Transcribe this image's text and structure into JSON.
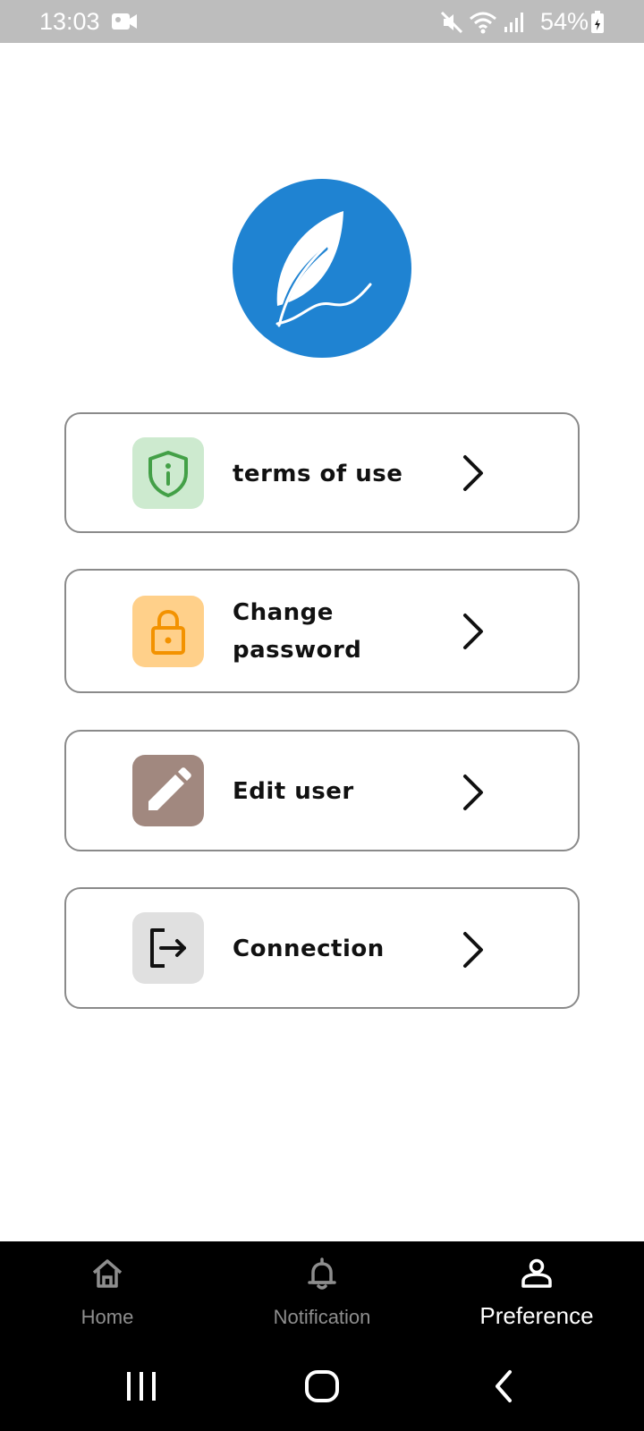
{
  "status_bar": {
    "time": "13:03",
    "battery": "54%",
    "icons": [
      "video-camera-icon",
      "mute-icon",
      "wifi-icon",
      "signal-icon",
      "battery-charging-icon"
    ]
  },
  "logo": {
    "icon": "leaf-quill-icon",
    "color": "#1f83d2"
  },
  "menu": {
    "items": [
      {
        "label": "terms of use",
        "icon": "shield-info-icon",
        "icon_bg": "#cdeacf",
        "icon_color": "#43a047"
      },
      {
        "label_line1": "Change",
        "label_line2": "password",
        "icon": "lock-icon",
        "icon_bg": "#ffd08a",
        "icon_color": "#f39200"
      },
      {
        "label": "Edit user",
        "icon": "pencil-icon",
        "icon_bg": "#a1887f",
        "icon_color": "#ffffff"
      },
      {
        "label": "Connection",
        "icon": "logout-icon",
        "icon_bg": "#e0e0e0",
        "icon_color": "#111111"
      }
    ]
  },
  "bottom_nav": {
    "items": [
      {
        "label": "Home",
        "icon": "home-icon",
        "active": false
      },
      {
        "label": "Notification",
        "icon": "bell-icon",
        "active": false
      },
      {
        "label": "Preference",
        "icon": "user-icon",
        "active": true
      }
    ]
  },
  "system_nav": {
    "buttons": [
      "recent-apps-icon",
      "home-circle-icon",
      "back-icon"
    ]
  }
}
